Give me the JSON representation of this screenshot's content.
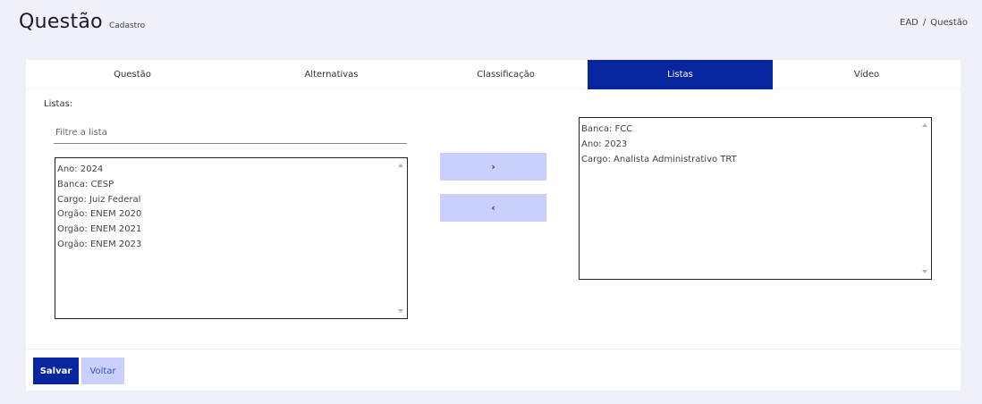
{
  "header": {
    "title": "Questão",
    "subtitle": "Cadastro"
  },
  "breadcrumb": {
    "items": [
      "EAD",
      "Questão"
    ],
    "separator": "/"
  },
  "tabs": [
    {
      "label": "Questão",
      "active": false
    },
    {
      "label": "Alternativas",
      "active": false
    },
    {
      "label": "Classificação",
      "active": false
    },
    {
      "label": "Listas",
      "active": true
    },
    {
      "label": "Vídeo",
      "active": false
    }
  ],
  "listas": {
    "label": "Listas:",
    "filter": {
      "placeholder": "Filtre a lista",
      "value": ""
    },
    "available": [
      "Ano: 2024",
      "Banca: CESP",
      "Cargo: Juiz Federal",
      "Orgão: ENEM 2020",
      "Orgão: ENEM 2021",
      "Orgão: ENEM 2023"
    ],
    "selected": [
      "Banca: FCC",
      "Ano: 2023",
      "Cargo: Analista Administrativo TRT"
    ],
    "move_right_label": "›",
    "move_left_label": "‹"
  },
  "actions": {
    "save_label": "Salvar",
    "back_label": "Voltar"
  },
  "colors": {
    "accent": "#06259e",
    "accent_light": "#c8d0fb",
    "background": "#eef0fa"
  }
}
